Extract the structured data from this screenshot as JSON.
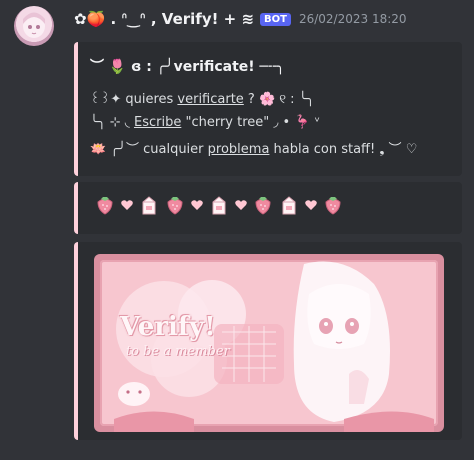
{
  "message": {
    "username": "✿🍑 . ᐢ‿ᐢ , Verify! + ≋",
    "bot_badge": "BOT",
    "timestamp": "26/02/2023 18:20"
  },
  "embed1": {
    "title": "︶ 🌷 ɞ : ╭╯verificate! ─╌╮",
    "line1_prefix": "꒰꒱✦ quieres ",
    "line1_link": "verificarte",
    "line1_suffix": " ? 🌸 ୧ : ╰╮",
    "line2_prefix": "╰╮ ⊹ ◟ ",
    "line2_link": "Escribe",
    "line2_suffix": " \"cherry tree\" ◞ • 🦩 ᵛ",
    "line3_prefix": "🪷 ╭╯︶ cualquier ",
    "line3_link": "problema",
    "line3_suffix": " habla con staff! ❟ ︶ ♡"
  },
  "banner": {
    "title": "Verify!",
    "subtitle": "to be a member"
  },
  "colors": {
    "background": "#313338",
    "embed_bg": "#2b2d31",
    "embed_accent": "#ffd1dc",
    "bot_badge": "#5865f2",
    "timestamp": "#949ba4"
  },
  "icons": {
    "strip": [
      "strawberry-icon",
      "heart-icon",
      "milk-carton-icon",
      "strawberry-icon",
      "heart-icon",
      "milk-carton-icon",
      "heart-icon",
      "strawberry-icon",
      "milk-carton-icon",
      "heart-icon",
      "strawberry-icon"
    ]
  }
}
